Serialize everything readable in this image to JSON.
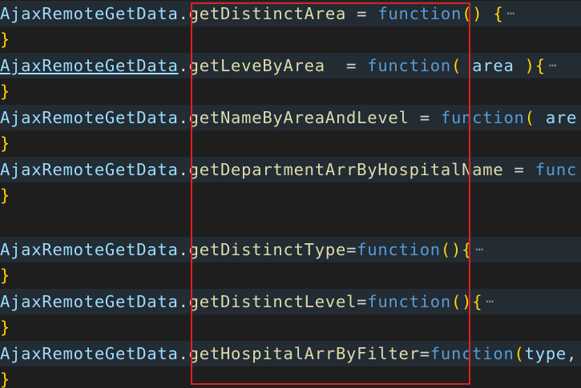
{
  "lines": [
    {
      "obj": "AjaxRemoteGetData",
      "dot": ".",
      "fn": "getDistinctArea",
      "op": " = ",
      "kw": "function",
      "paren_open": "(",
      "param": "",
      "paren_close": ")",
      "brace": " {",
      "ellipsis": "⋯"
    },
    {
      "brace": "}"
    },
    {
      "obj": "AjaxRemoteGetData",
      "dot": ".",
      "fn": "getLeveByArea",
      "op": "  = ",
      "kw": "function",
      "paren_open": "(",
      "param": " area ",
      "paren_close": ")",
      "brace": "{",
      "ellipsis": "⋯"
    },
    {
      "brace": "}"
    },
    {
      "obj": "AjaxRemoteGetData",
      "dot": ".",
      "fn": "getNameByAreaAndLevel",
      "op": " = ",
      "kw": "function",
      "paren_open": "(",
      "param": " are"
    },
    {
      "brace": "}"
    },
    {
      "obj": "AjaxRemoteGetData",
      "dot": ".",
      "fn": "getDepartmentArrByHospitalName",
      "op": " = ",
      "kw": "func"
    },
    {
      "brace": "}"
    },
    {},
    {
      "obj": "AjaxRemoteGetData",
      "dot": ".",
      "fn": "getDistinctType",
      "op": "=",
      "kw": "function",
      "paren_open": "(",
      "paren_close": ")",
      "brace": "{",
      "ellipsis": "⋯"
    },
    {
      "brace": "}"
    },
    {
      "obj": "AjaxRemoteGetData",
      "dot": ".",
      "fn": "getDistinctLevel",
      "op": "=",
      "kw": "function",
      "paren_open": "(",
      "paren_close": ")",
      "brace": "{",
      "ellipsis": "⋯"
    },
    {
      "brace": "}"
    },
    {
      "obj": "AjaxRemoteGetData",
      "dot": ".",
      "fn": "getHospitalArrByFilter",
      "op": "=",
      "kw": "function",
      "paren_open": "(",
      "param": "type",
      "punc": ","
    },
    {
      "brace": "}"
    }
  ],
  "colors": {
    "background": "#1e1e1e",
    "folded_line_background": "#232b33",
    "object": "#9cdcfe",
    "function_name": "#dcdcaa",
    "keyword": "#569cd6",
    "bracket": "#ffd700",
    "annotation_box": "#e02020"
  }
}
